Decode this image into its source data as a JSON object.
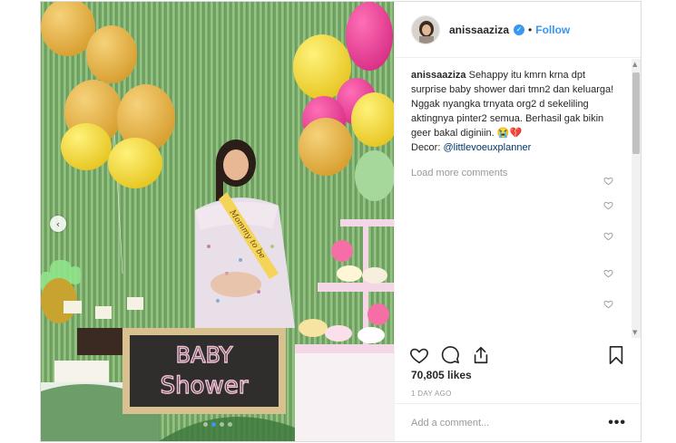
{
  "post": {
    "username": "anissaaziza",
    "follow_label": "Follow",
    "separator": "•",
    "verified_glyph": "✓",
    "caption_user": "anissaaziza",
    "caption_text": " Sehappy itu kmrn krna dpt surprise baby shower dari tmn2 dan keluarga! Nggak nyangka trnyata org2 d sekeliling aktingnya pinter2 semua. Berhasil gak bikin geer bakal diginiin. 😭💔",
    "decor_label": "Decor: ",
    "decor_mention": "@littlevoeuxplanner",
    "load_more": "Load more comments",
    "likes": "70,805 likes",
    "date": "1 DAY AGO",
    "comment_placeholder": "Add a comment...",
    "more_glyph": "•••",
    "prev_glyph": "‹",
    "scroll_up": "▲",
    "scroll_down": "▼"
  },
  "photo": {
    "chalkboard_line1": "BABY",
    "chalkboard_line2": "Shower",
    "sash_text": "Mommy to be"
  },
  "colors": {
    "accent": "#3897f0",
    "text": "#262626",
    "muted": "#999999",
    "border": "#dbdbdb"
  },
  "icons": [
    "heart-icon",
    "comment-icon",
    "share-icon",
    "bookmark-icon",
    "verified-icon",
    "more-icon",
    "chevron-left-icon"
  ]
}
